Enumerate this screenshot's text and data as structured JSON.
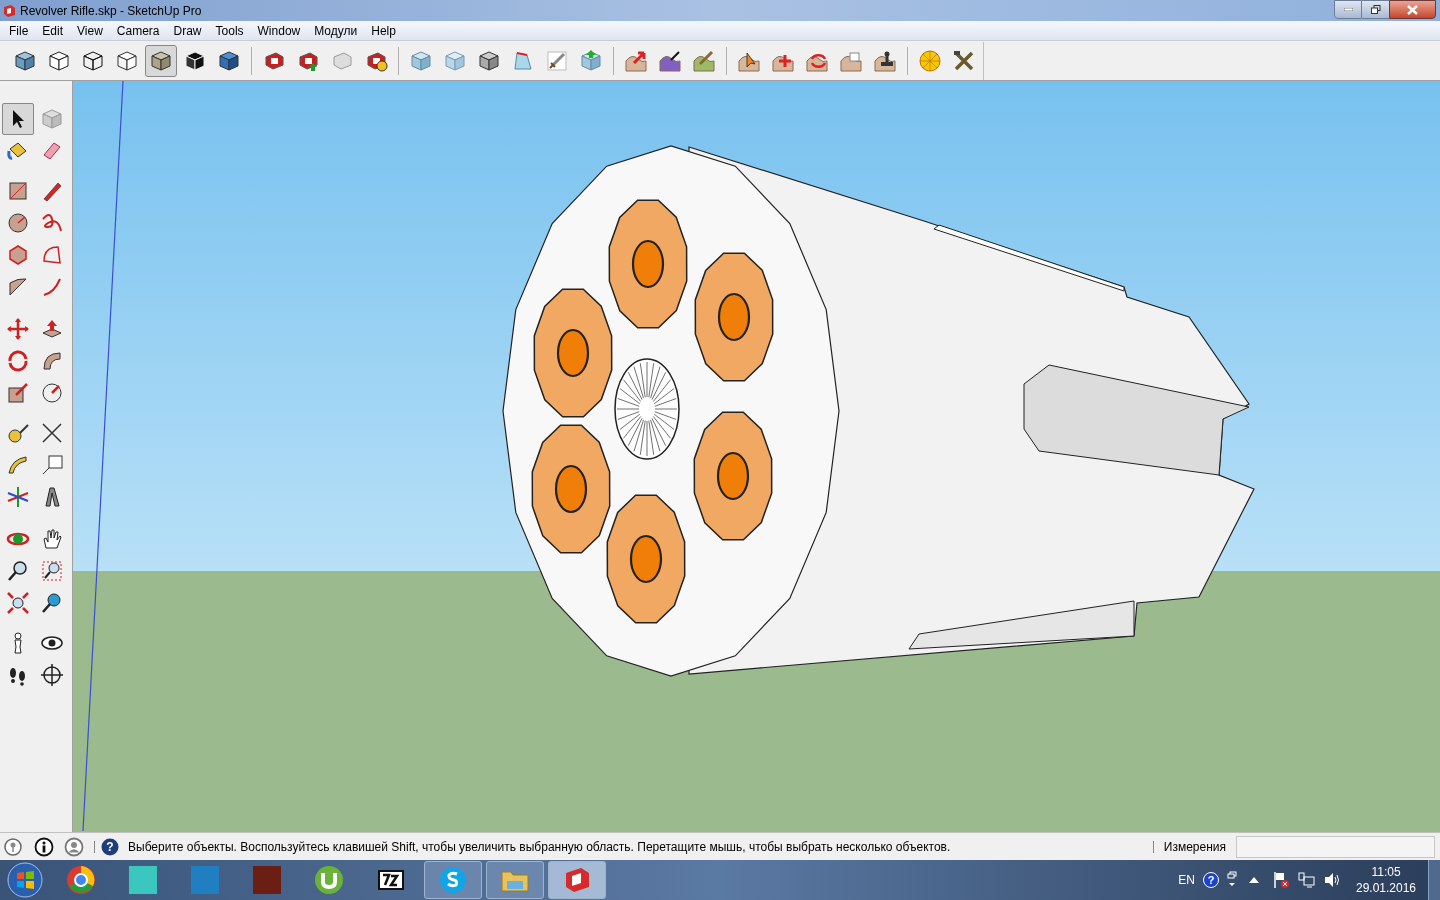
{
  "window": {
    "title": "Revolver Rifle.skp - SketchUp Pro"
  },
  "menu": [
    "File",
    "Edit",
    "View",
    "Camera",
    "Draw",
    "Tools",
    "Window",
    "Модули",
    "Help"
  ],
  "toolbar": [
    {
      "selected": false
    },
    {
      "selected": false
    },
    {
      "selected": false
    },
    {
      "selected": false
    },
    {
      "selected": true
    },
    {
      "selected": false
    },
    {
      "selected": false
    },
    {
      "selected": false
    },
    {
      "selected": false
    },
    {
      "selected": false
    },
    {
      "selected": false
    },
    {
      "selected": false
    },
    {
      "selected": false
    },
    {
      "selected": false
    },
    {
      "selected": false
    },
    {
      "selected": false
    },
    {
      "selected": false
    },
    {
      "selected": false
    },
    {
      "selected": false
    },
    {
      "selected": false
    },
    {
      "selected": false
    },
    {
      "selected": false
    },
    {
      "selected": false
    },
    {
      "selected": false
    },
    {
      "selected": false
    },
    {
      "selected": false
    },
    {
      "selected": false
    }
  ],
  "tool_palette": [
    {
      "selected": true
    },
    {
      "selected": false
    },
    {
      "selected": false
    },
    {
      "selected": false
    },
    {
      "selected": false
    },
    {
      "selected": false
    },
    {
      "selected": false
    },
    {
      "selected": false
    },
    {
      "selected": false
    },
    {
      "selected": false
    },
    {
      "selected": false
    },
    {
      "selected": false
    },
    {
      "selected": false
    },
    {
      "selected": false
    },
    {
      "selected": false
    },
    {
      "selected": false
    },
    {
      "selected": false
    },
    {
      "selected": false
    },
    {
      "selected": false
    },
    {
      "selected": false
    },
    {
      "selected": false
    },
    {
      "selected": false
    },
    {
      "selected": false
    },
    {
      "selected": false
    },
    {
      "selected": false
    },
    {
      "selected": false
    },
    {
      "selected": false
    },
    {
      "selected": false
    },
    {
      "selected": false
    },
    {
      "selected": false
    },
    {
      "selected": false
    },
    {
      "selected": false
    },
    {
      "selected": false
    },
    {
      "selected": false
    }
  ],
  "status_bar": {
    "message": "Выберите объекты. Воспользуйтесь клавишей Shift, чтобы увеличить выбранную область. Перетащите мышь, чтобы выбрать несколько объектов.",
    "measurements_label": "Измерения",
    "help_glyph": "?"
  },
  "taskbar": {
    "apps": [
      {
        "running": false,
        "selected": false
      },
      {
        "running": false,
        "selected": false
      },
      {
        "running": false,
        "selected": false
      },
      {
        "running": false,
        "selected": false
      },
      {
        "running": false,
        "selected": false
      },
      {
        "running": false,
        "selected": false
      },
      {
        "running": true,
        "selected": false
      },
      {
        "running": true,
        "selected": false
      },
      {
        "running": true,
        "selected": true
      }
    ],
    "language": "EN",
    "help_glyph": "?",
    "time": "11:05",
    "date": "29.01.2016"
  }
}
